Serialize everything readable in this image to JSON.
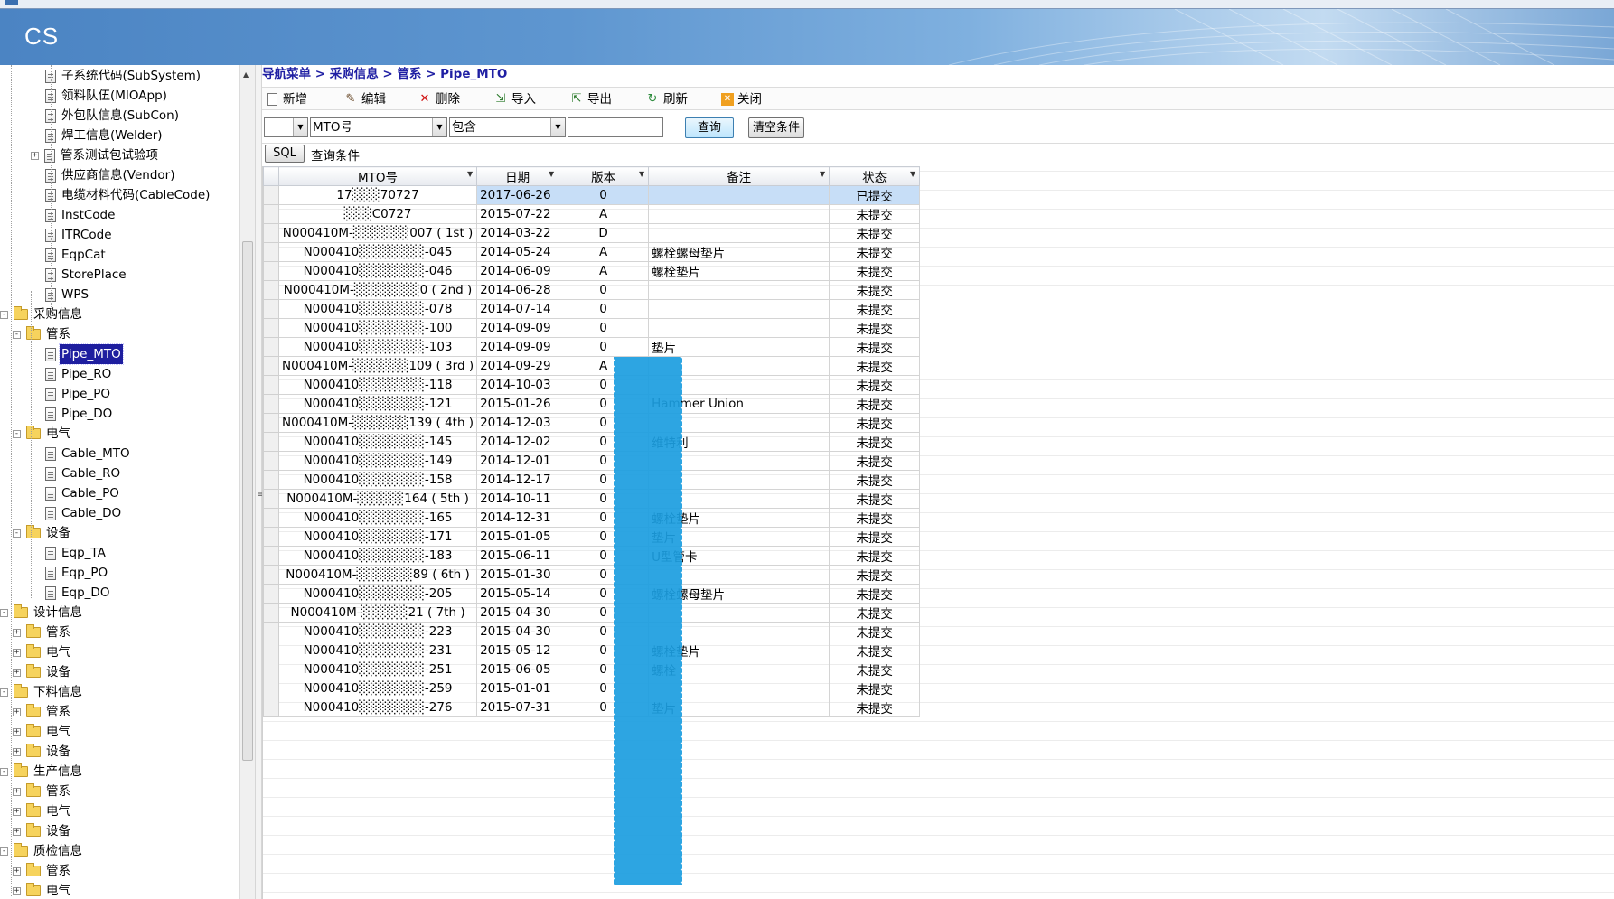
{
  "app": {
    "logo": "CS"
  },
  "sidebar": {
    "items": [
      {
        "label": "子系统代码(SubSystem)",
        "type": "doc",
        "level": 2
      },
      {
        "label": "领料队伍(MIOApp)",
        "type": "doc",
        "level": 2
      },
      {
        "label": "外包队信息(SubCon)",
        "type": "doc",
        "level": 2
      },
      {
        "label": "焊工信息(Welder)",
        "type": "doc",
        "level": 2
      },
      {
        "label": "管系测试包试验项",
        "type": "doc",
        "level": 2,
        "expander": "+"
      },
      {
        "label": "供应商信息(Vendor)",
        "type": "doc",
        "level": 2
      },
      {
        "label": "电缆材料代码(CableCode)",
        "type": "doc",
        "level": 2
      },
      {
        "label": "InstCode",
        "type": "doc",
        "level": 2
      },
      {
        "label": "ITRCode",
        "type": "doc",
        "level": 2
      },
      {
        "label": "EqpCat",
        "type": "doc",
        "level": 2
      },
      {
        "label": "StorePlace",
        "type": "doc",
        "level": 2
      },
      {
        "label": "WPS",
        "type": "doc",
        "level": 2
      },
      {
        "label": "采购信息",
        "type": "folder",
        "level": 0,
        "expander": "−"
      },
      {
        "label": "管系",
        "type": "folder",
        "level": 1,
        "expander": "−"
      },
      {
        "label": "Pipe_MTO",
        "type": "doc",
        "level": 2,
        "selected": true
      },
      {
        "label": "Pipe_RO",
        "type": "doc",
        "level": 2
      },
      {
        "label": "Pipe_PO",
        "type": "doc",
        "level": 2
      },
      {
        "label": "Pipe_DO",
        "type": "doc",
        "level": 2
      },
      {
        "label": "电气",
        "type": "folder",
        "level": 1,
        "expander": "−"
      },
      {
        "label": "Cable_MTO",
        "type": "doc",
        "level": 2
      },
      {
        "label": "Cable_RO",
        "type": "doc",
        "level": 2
      },
      {
        "label": "Cable_PO",
        "type": "doc",
        "level": 2
      },
      {
        "label": "Cable_DO",
        "type": "doc",
        "level": 2
      },
      {
        "label": "设备",
        "type": "folder",
        "level": 1,
        "expander": "−"
      },
      {
        "label": "Eqp_TA",
        "type": "doc",
        "level": 2
      },
      {
        "label": "Eqp_PO",
        "type": "doc",
        "level": 2
      },
      {
        "label": "Eqp_DO",
        "type": "doc",
        "level": 2
      },
      {
        "label": "设计信息",
        "type": "folder",
        "level": 0,
        "expander": "−"
      },
      {
        "label": "管系",
        "type": "folder",
        "level": 1,
        "expander": "+"
      },
      {
        "label": "电气",
        "type": "folder",
        "level": 1,
        "expander": "+"
      },
      {
        "label": "设备",
        "type": "folder",
        "level": 1,
        "expander": "+"
      },
      {
        "label": "下料信息",
        "type": "folder",
        "level": 0,
        "expander": "−"
      },
      {
        "label": "管系",
        "type": "folder",
        "level": 1,
        "expander": "+"
      },
      {
        "label": "电气",
        "type": "folder",
        "level": 1,
        "expander": "+"
      },
      {
        "label": "设备",
        "type": "folder",
        "level": 1,
        "expander": "+"
      },
      {
        "label": "生产信息",
        "type": "folder",
        "level": 0,
        "expander": "−"
      },
      {
        "label": "管系",
        "type": "folder",
        "level": 1,
        "expander": "+"
      },
      {
        "label": "电气",
        "type": "folder",
        "level": 1,
        "expander": "+"
      },
      {
        "label": "设备",
        "type": "folder",
        "level": 1,
        "expander": "+"
      },
      {
        "label": "质检信息",
        "type": "folder",
        "level": 0,
        "expander": "−"
      },
      {
        "label": "管系",
        "type": "folder",
        "level": 1,
        "expander": "+"
      },
      {
        "label": "电气",
        "type": "folder",
        "level": 1,
        "expander": "+"
      }
    ]
  },
  "breadcrumb": "导航菜单 > 采购信息 > 管系 > Pipe_MTO",
  "toolbar": {
    "add": "新增",
    "edit": "编辑",
    "delete": "删除",
    "import": "导入",
    "export": "导出",
    "refresh": "刷新",
    "close": "关闭"
  },
  "filter": {
    "field_value": "MTO号",
    "operator_value": "包含",
    "query_label": "查询",
    "clear_label": "清空条件"
  },
  "sql": {
    "button": "SQL",
    "condition_label": "查询条件"
  },
  "grid": {
    "columns": [
      "MTO号",
      "日期",
      "版本",
      "备注",
      "状态"
    ],
    "rows": [
      [
        "17░░░70727",
        "2017-06-26",
        "0",
        "",
        "已提交"
      ],
      [
        "░░░C0727",
        "2015-07-22",
        "A",
        "",
        "未提交"
      ],
      [
        "N000410M-░░░░░░007 ( 1st )",
        "2014-03-22",
        "D",
        "",
        "未提交"
      ],
      [
        "N000410░░░░░░░-045",
        "2014-05-24",
        "A",
        "螺栓螺母垫片",
        "未提交"
      ],
      [
        "N000410░░░░░░░-046",
        "2014-06-09",
        "A",
        "螺栓垫片",
        "未提交"
      ],
      [
        "N000410M-░░░░░░░0 ( 2nd )",
        "2014-06-28",
        "0",
        "",
        "未提交"
      ],
      [
        "N000410░░░░░░░-078",
        "2014-07-14",
        "0",
        "",
        "未提交"
      ],
      [
        "N000410░░░░░░░-100",
        "2014-09-09",
        "0",
        "",
        "未提交"
      ],
      [
        "N000410░░░░░░░-103",
        "2014-09-09",
        "0",
        "垫片",
        "未提交"
      ],
      [
        "N000410M-░░░░░░109 ( 3rd )",
        "2014-09-29",
        "A",
        "",
        "未提交"
      ],
      [
        "N000410░░░░░░░-118",
        "2014-10-03",
        "0",
        "",
        "未提交"
      ],
      [
        "N000410░░░░░░░-121",
        "2015-01-26",
        "0",
        "Hammer Union",
        "未提交"
      ],
      [
        "N000410M-░░░░░░139 ( 4th )",
        "2014-12-03",
        "0",
        "",
        "未提交"
      ],
      [
        "N000410░░░░░░░-145",
        "2014-12-02",
        "0",
        "维特利",
        "未提交"
      ],
      [
        "N000410░░░░░░░-149",
        "2014-12-01",
        "0",
        "",
        "未提交"
      ],
      [
        "N000410░░░░░░░-158",
        "2014-12-17",
        "0",
        "",
        "未提交"
      ],
      [
        "N000410M-░░░░░164 ( 5th )",
        "2014-10-11",
        "0",
        "",
        "未提交"
      ],
      [
        "N000410░░░░░░░-165",
        "2014-12-31",
        "0",
        "螺栓垫片",
        "未提交"
      ],
      [
        "N000410░░░░░░░-171",
        "2015-01-05",
        "0",
        "垫片",
        "未提交"
      ],
      [
        "N000410░░░░░░░-183",
        "2015-06-11",
        "0",
        "U型管卡",
        "未提交"
      ],
      [
        "N000410M-░░░░░░89 ( 6th )",
        "2015-01-30",
        "0",
        "",
        "未提交"
      ],
      [
        "N000410░░░░░░░-205",
        "2015-05-14",
        "0",
        "螺栓螺母垫片",
        "未提交"
      ],
      [
        "N000410M-░░░░░21 ( 7th )",
        "2015-04-30",
        "0",
        "",
        "未提交"
      ],
      [
        "N000410░░░░░░░-223",
        "2015-04-30",
        "0",
        "",
        "未提交"
      ],
      [
        "N000410░░░░░░░-231",
        "2015-05-12",
        "0",
        "螺栓垫片",
        "未提交"
      ],
      [
        "N000410░░░░░░░-251",
        "2015-06-05",
        "0",
        "螺栓",
        "未提交"
      ],
      [
        "N000410░░░░░░░-259",
        "2015-01-01",
        "0",
        "",
        "未提交"
      ],
      [
        "N000410░░░░░░░-276",
        "2015-07-31",
        "0",
        "垫片",
        "未提交"
      ]
    ]
  },
  "colors": {
    "accent": "#1e1e9f",
    "selection": "#c7def7",
    "mask": "#1b9de0"
  }
}
